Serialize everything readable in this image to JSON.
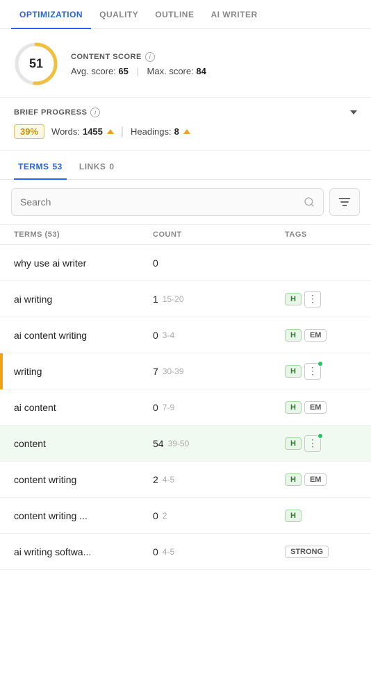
{
  "nav": {
    "tabs": [
      {
        "id": "optimization",
        "label": "OPTIMIZATION",
        "active": true
      },
      {
        "id": "quality",
        "label": "QUALITY",
        "active": false
      },
      {
        "id": "outline",
        "label": "OUTLINE",
        "active": false
      },
      {
        "id": "ai_writer",
        "label": "AI WRITER",
        "active": false
      }
    ]
  },
  "content_score": {
    "title": "CONTENT SCORE",
    "info_label": "i",
    "score": "51",
    "avg_label": "Avg. score:",
    "avg_value": "65",
    "max_label": "Max. score:",
    "max_value": "84",
    "arc_percent": 51
  },
  "brief_progress": {
    "title": "BRIEF PROGRESS",
    "info_label": "i",
    "percentage": "39%",
    "words_label": "Words:",
    "words_value": "1455",
    "headings_label": "Headings:",
    "headings_value": "8"
  },
  "sub_tabs": [
    {
      "id": "terms",
      "label": "TERMS",
      "count": "53",
      "active": true
    },
    {
      "id": "links",
      "label": "LINKS",
      "count": "0",
      "active": false
    }
  ],
  "search": {
    "placeholder": "Search",
    "filter_icon": "≡"
  },
  "table": {
    "columns": [
      {
        "id": "terms",
        "label": "TERMS (53)"
      },
      {
        "id": "count",
        "label": "COUNT"
      },
      {
        "id": "tags",
        "label": "TAGS"
      }
    ],
    "rows": [
      {
        "term": "why use ai writer",
        "count": "0",
        "range": "",
        "tags": [],
        "dots": false,
        "h_tag": false,
        "highlighted": false,
        "accent": false
      },
      {
        "term": "ai writing",
        "count": "1",
        "range": "15-20",
        "tags": [
          "H"
        ],
        "dots": true,
        "highlighted": false,
        "accent": false,
        "dot_green": false
      },
      {
        "term": "ai content writing",
        "count": "0",
        "range": "3-4",
        "tags": [
          "H",
          "EM"
        ],
        "dots": false,
        "highlighted": false,
        "accent": false
      },
      {
        "term": "writing",
        "count": "7",
        "range": "30-39",
        "tags": [
          "H"
        ],
        "dots": true,
        "highlighted": false,
        "accent": true,
        "dot_green": true
      },
      {
        "term": "ai content",
        "count": "0",
        "range": "7-9",
        "tags": [
          "H",
          "EM"
        ],
        "dots": false,
        "highlighted": false,
        "accent": false
      },
      {
        "term": "content",
        "count": "54",
        "range": "39-50",
        "tags": [
          "H"
        ],
        "dots": true,
        "highlighted": true,
        "accent": false,
        "dot_green": true
      },
      {
        "term": "content writing",
        "count": "2",
        "range": "4-5",
        "tags": [
          "H",
          "EM"
        ],
        "dots": false,
        "highlighted": false,
        "accent": false
      },
      {
        "term": "content writing ...",
        "count": "0",
        "range": "2",
        "tags": [
          "H"
        ],
        "dots": false,
        "highlighted": false,
        "accent": false
      },
      {
        "term": "ai writing softwa...",
        "count": "0",
        "range": "4-5",
        "tags": [
          "STRONG"
        ],
        "dots": false,
        "highlighted": false,
        "accent": false
      }
    ]
  }
}
